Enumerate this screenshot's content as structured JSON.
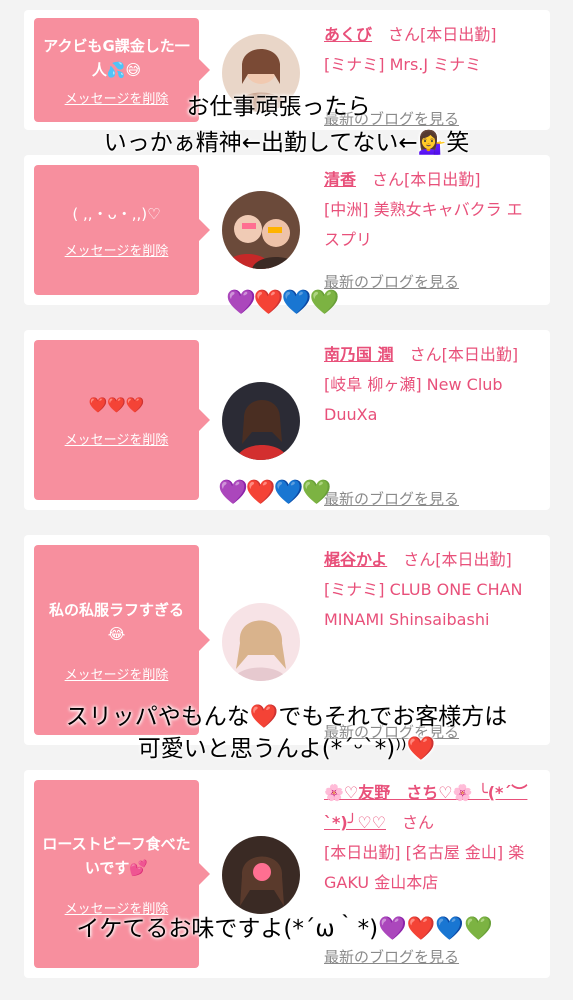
{
  "cards": [
    {
      "message": "アクビもG課金した一人💦😅",
      "delete": "メッセージを削除",
      "name": "あくび",
      "suffix": "さん[本日出勤]",
      "shop": "[ミナミ] Mrs.J ミナミ",
      "blog": "最新のブログを見る"
    },
    {
      "message": "( ,,・ᴗ・,,)♡",
      "delete": "メッセージを削除",
      "name": "清香",
      "suffix": "さん[本日出勤]",
      "shop": "[中洲] 美熟女キャバクラ エスプリ",
      "blog": "最新のブログを見る"
    },
    {
      "message": "❤️❤️❤️",
      "delete": "メッセージを削除",
      "name": "南乃国 潤",
      "suffix": "さん[本日出勤]",
      "shop": "[岐阜 柳ヶ瀬] New Club DuuXa",
      "blog": "最新のブログを見る"
    },
    {
      "message": "私の私服ラフすぎる😂",
      "delete": "メッセージを削除",
      "name": "梶谷かよ",
      "suffix": "さん[本日出勤]",
      "shop": "[ミナミ] CLUB ONE CHAN MINAMI Shinsaibashi",
      "blog": "最新のブログを見る"
    },
    {
      "message": "ローストビーフ食べたいです💕",
      "delete": "メッセージを削除",
      "name": "🌸♡友野　さち♡🌸 ╰(*´︶`*)╯♡♡",
      "suffix": "さん",
      "shop": "[本日出勤] [名古屋 金山] 楽GAKU 金山本店",
      "blog": "最新のブログを見る"
    }
  ],
  "overlays": {
    "caption1_line1": "お仕事頑張ったら",
    "caption1_line2": "いっかぁ精神←出勤してない←💁‍♀️笑",
    "caption2_line1": "スリッパやもんな❤️でもそれでお客様方は",
    "caption2_line2": "可愛いと思うんよ(*ˊᵕˋ*)⁾⁾❤️",
    "caption3": "イケてるお味ですよ(*´ω｀*)💜❤️💙💚",
    "hearts1": "💜❤️💙💚",
    "hearts2": "💜❤️💙💚"
  }
}
